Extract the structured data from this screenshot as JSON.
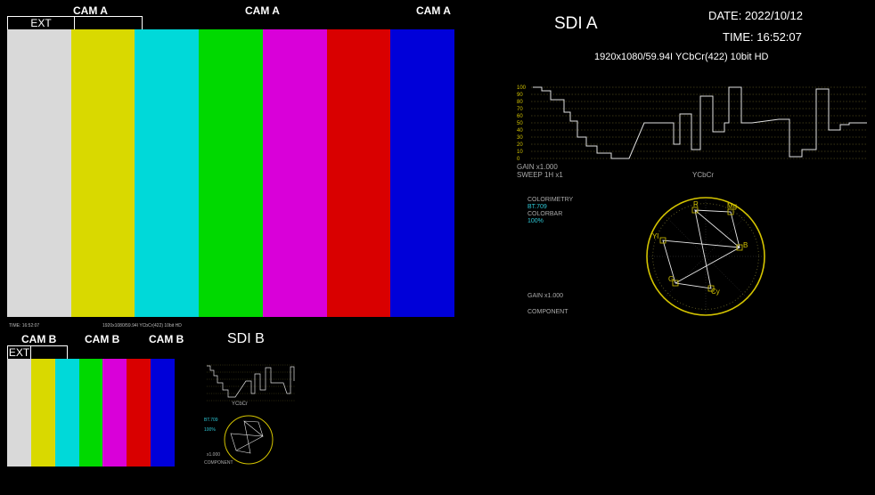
{
  "main_monitor": {
    "cam_labels": [
      "CAM A",
      "CAM A",
      "CAM A"
    ],
    "ext_label": "EXT",
    "colorbars": [
      "#d9d9d9",
      "#d9d900",
      "#00d9d9",
      "#00d900",
      "#d900d9",
      "#d90000",
      "#0000d9"
    ],
    "time_text": "TIME: 16:52:07",
    "format_text": "1920x1080/59.94I YCbCr(422) 10bit HD"
  },
  "sdi_a": {
    "title": "SDI A",
    "date": "DATE: 2022/10/12",
    "time": "TIME: 16:52:07",
    "format": "1920x1080/59.94I YCbCr(422) 10bit HD",
    "waveform": {
      "scale": [
        "100",
        "90",
        "80",
        "70",
        "60",
        "50",
        "40",
        "30",
        "20",
        "10",
        "0"
      ],
      "gain": "GAIN x1.000",
      "sweep": "SWEEP 1H x1",
      "mode": "YCbCr"
    },
    "vector": {
      "colorimetry_label": "COLORIMETRY",
      "colorimetry_value": "BT.709",
      "colorbar_label": "COLORBAR",
      "colorbar_value": "100%",
      "gain": "GAIN x1.000",
      "mode": "COMPONENT",
      "targets": [
        "R",
        "Mg",
        "B",
        "Cy",
        "G",
        "Yl"
      ]
    }
  },
  "sdi_b": {
    "cam_labels": [
      "CAM B",
      "CAM B",
      "CAM B"
    ],
    "ext_label": "EXT",
    "title": "SDI B",
    "waveform_mode": "YCbCr",
    "colorimetry_value": "BT.709",
    "colorbar_value": "100%",
    "gain": "x1.000",
    "mode": "COMPONENT"
  },
  "colors": {
    "accent_cyan": "#2ec8d6",
    "scope_yellow": "#d4c400",
    "grid": "#6f6a2a"
  }
}
